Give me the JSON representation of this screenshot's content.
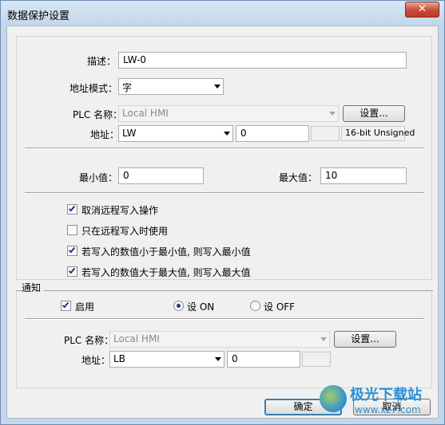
{
  "window": {
    "title": "数据保护设置",
    "close_label": "✕"
  },
  "description": {
    "label": "描述：",
    "value": "LW-0"
  },
  "address_mode": {
    "label": "地址模式：",
    "value": "字"
  },
  "plc1": {
    "plc_name_label": "PLC 名称：",
    "plc_name_value": "Local HMI",
    "settings_label": "设置...",
    "address_label": "地址：",
    "address_device": "LW",
    "address_value": "0",
    "format_text": "16-bit Unsigned"
  },
  "limits": {
    "min_label": "最小值：",
    "min_value": "0",
    "max_label": "最大值：",
    "max_value": "10"
  },
  "options": [
    {
      "label": "取消远程写入操作",
      "checked": true
    },
    {
      "label": "只在远程写入时使用",
      "checked": false
    },
    {
      "label": "若写入的数值小于最小值, 则写入最小值",
      "checked": true
    },
    {
      "label": "若写入的数值大于最大值, 则写入最大值",
      "checked": true
    }
  ],
  "notify": {
    "section_label": "通知",
    "enable_label": "启用",
    "enable_checked": true,
    "on_label": "设 ON",
    "off_label": "设 OFF",
    "selected": "ON"
  },
  "plc2": {
    "plc_name_label": "PLC 名称：",
    "plc_name_value": "Local HMI",
    "settings_label": "设置...",
    "address_label": "地址：",
    "address_device": "LB",
    "address_value": "0"
  },
  "footer": {
    "ok_label": "确定",
    "cancel_label": "取消"
  },
  "watermark": {
    "brand": "极光下载站",
    "url": "www.xz7.com"
  },
  "colors": {
    "accent": "#3c7fb1",
    "close": "#c74a36",
    "check": "#1d3b8a"
  }
}
